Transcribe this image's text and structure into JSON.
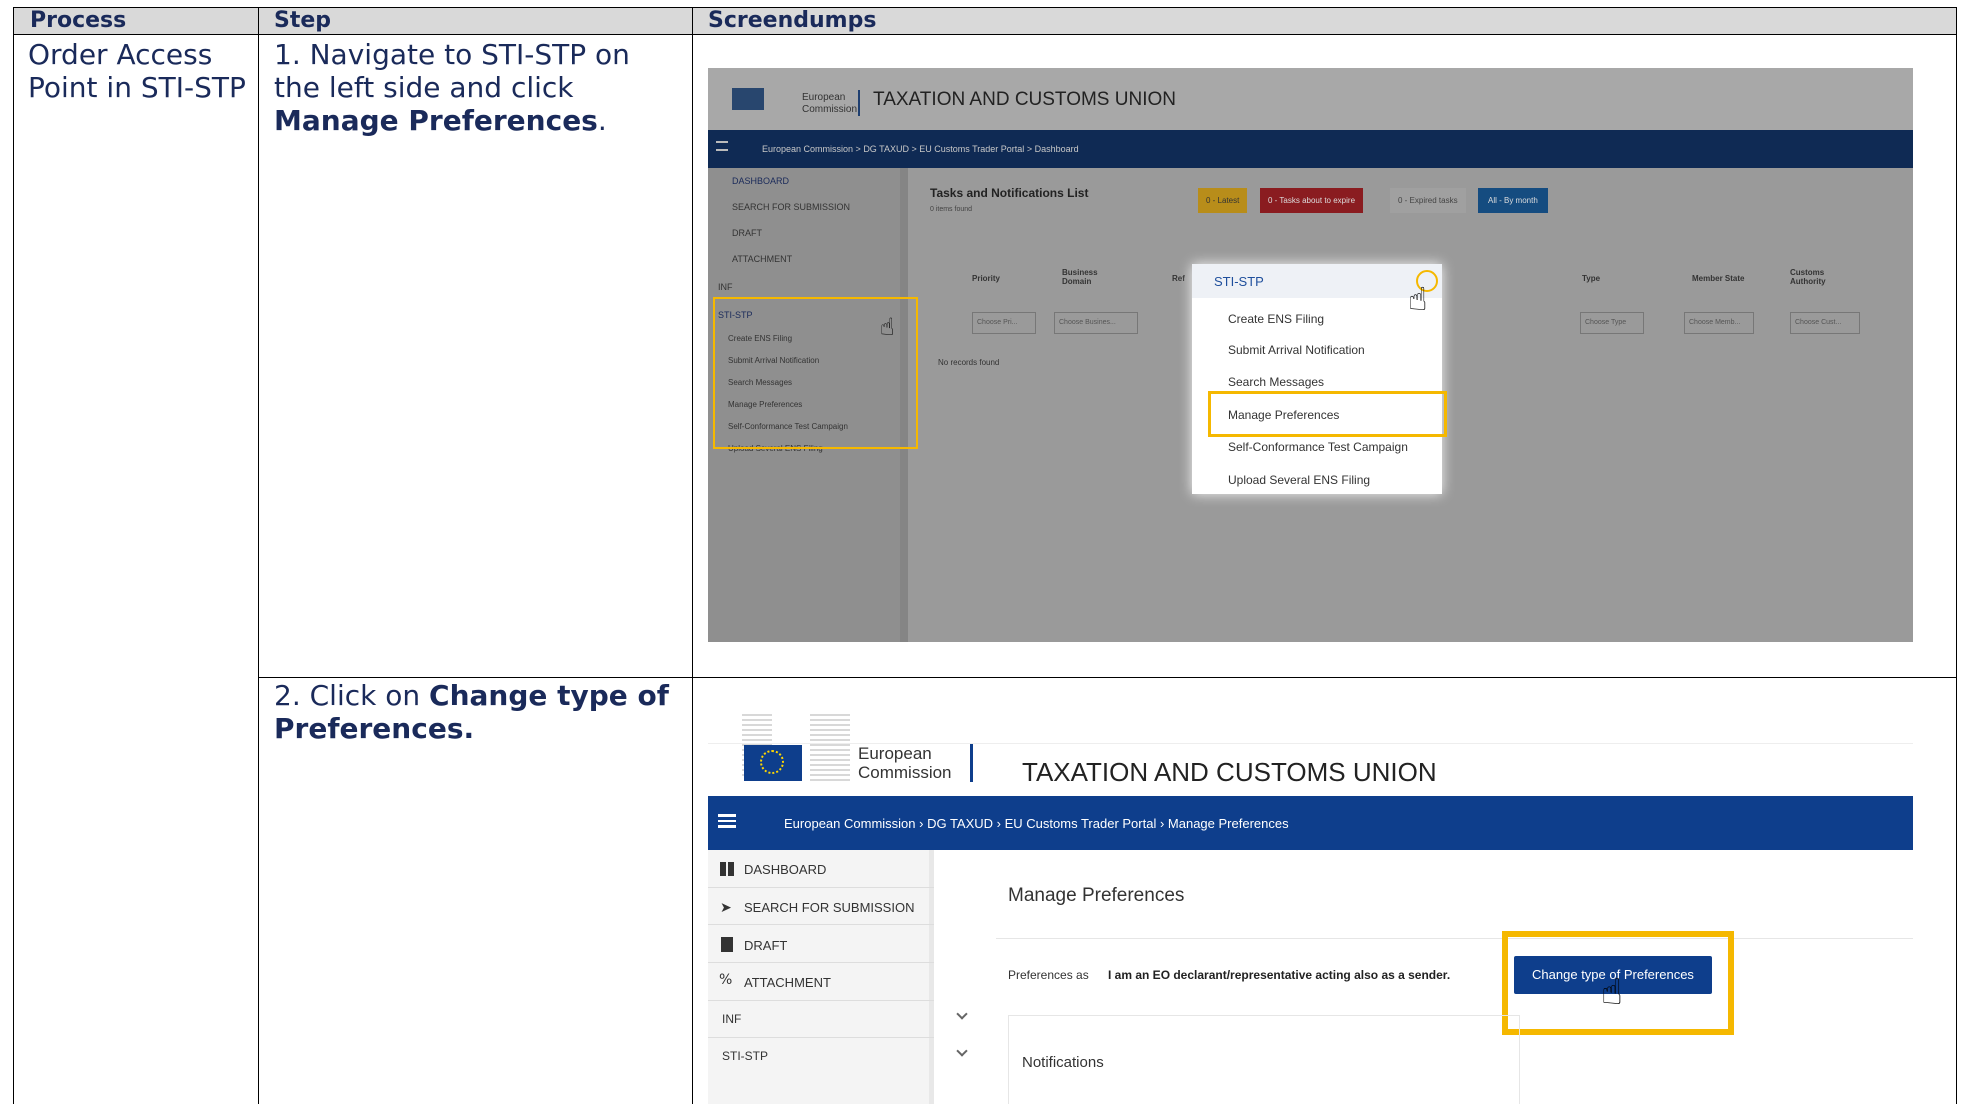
{
  "table": {
    "headers": [
      "Process",
      "Step",
      "Screendumps"
    ],
    "process": "Order Access Point in STI-STP",
    "step1": {
      "prefix": "1. Navigate to STI-STP on the left side and click ",
      "bold": "Manage Preferences",
      "suffix": "."
    },
    "step2": {
      "prefix": "2. Click on ",
      "bold": "Change type of Preferences."
    }
  },
  "shot1": {
    "brand_top": "European",
    "brand_bottom": "Commission",
    "portal_title": "TAXATION AND CUSTOMS UNION",
    "breadcrumb": [
      "European Commission",
      "DG TAXUD",
      "EU Customs Trader Portal",
      "Dashboard"
    ],
    "sidebar": [
      "DASHBOARD",
      "SEARCH FOR SUBMISSION",
      "DRAFT",
      "ATTACHMENT",
      "INF",
      "STI-STP"
    ],
    "sidebar_sub": [
      "Create ENS Filing",
      "Submit Arrival Notification",
      "Search Messages",
      "Manage Preferences",
      "Self-Conformance Test Campaign",
      "Upload Several ENS Filing"
    ],
    "list_title": "Tasks and Notifications List",
    "list_sub": "0 items found",
    "badges": [
      {
        "label": "0 - Latest",
        "color": "#f3b500"
      },
      {
        "label": "0 - Tasks about to expire",
        "color": "#d0202a"
      },
      {
        "label": "0 - Expired tasks",
        "color": "#bdbdbd"
      },
      {
        "label": "All - By month",
        "color": "#1f6fb8"
      }
    ],
    "columns": [
      "Priority",
      "Business Domain",
      "Ref",
      "Type",
      "Member State",
      "Customs Authority"
    ],
    "filters": [
      "Choose Pri...",
      "Choose Busines...",
      "Choose Type",
      "Choose Memb...",
      "Choose Cust..."
    ],
    "no_records": "No records found",
    "popup_header": "STI-STP",
    "popup_items": [
      "Create ENS Filing",
      "Submit Arrival Notification",
      "Search Messages",
      "Manage Preferences",
      "Self-Conformance Test Campaign",
      "Upload Several ENS Filing"
    ]
  },
  "shot2": {
    "brand_top": "European",
    "brand_bottom": "Commission",
    "portal_title": "TAXATION AND CUSTOMS UNION",
    "breadcrumb": [
      "European Commission",
      "DG TAXUD",
      "EU Customs Trader Portal",
      "Manage Preferences"
    ],
    "sidebar": [
      "DASHBOARD",
      "SEARCH FOR SUBMISSION",
      "DRAFT",
      "ATTACHMENT",
      "INF",
      "STI-STP"
    ],
    "page_title": "Manage Preferences",
    "pref_label": "Preferences as",
    "pref_value": "I am an EO declarant/representative acting also as a sender.",
    "change_button": "Change type of Preferences",
    "notifications": "Notifications"
  },
  "colors": {
    "highlight": "#f5b800",
    "navy": "#0e3e8c",
    "text": "#1a2a5a"
  }
}
